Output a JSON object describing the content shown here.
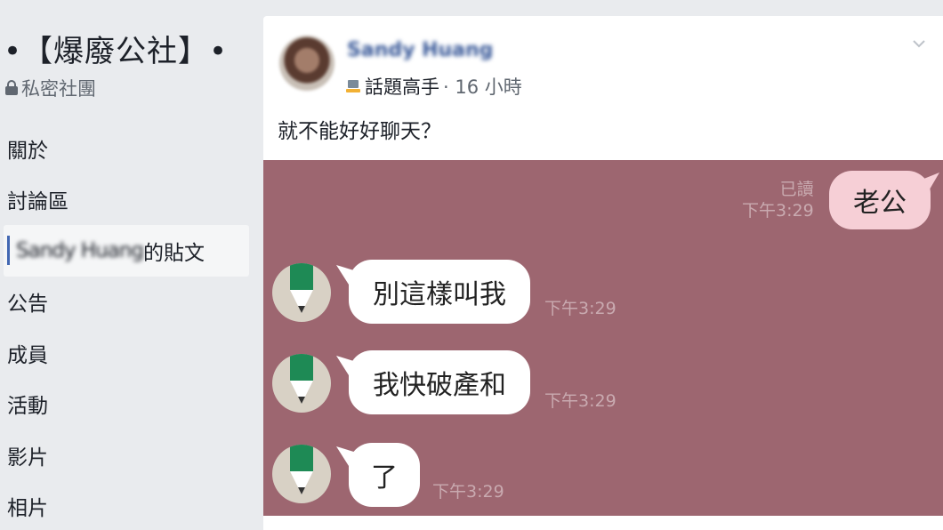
{
  "sidebar": {
    "group_title": "•【爆廢公社】•",
    "group_type": "私密社團",
    "items": [
      {
        "label": "關於"
      },
      {
        "label": "討論區"
      },
      {
        "label": "的貼文",
        "name_blurred": "Sandy Huang",
        "active": true
      },
      {
        "label": "公告"
      },
      {
        "label": "成員"
      },
      {
        "label": "活動"
      },
      {
        "label": "影片"
      },
      {
        "label": "相片"
      }
    ]
  },
  "post": {
    "author": "Sandy Huang",
    "badge": "話題高手",
    "time": "· 16 小時",
    "text": "就不能好好聊天？",
    "icons": [
      "badge-icon",
      "chevron-down-icon"
    ]
  },
  "chat": {
    "messages": [
      {
        "side": "out",
        "text": "老公",
        "read": "已讀",
        "time": "下午3:29"
      },
      {
        "side": "in",
        "text": "別這樣叫我",
        "time": "下午3:29"
      },
      {
        "side": "in",
        "text": "我快破產和",
        "time": "下午3:29"
      },
      {
        "side": "in",
        "text": "了",
        "time": "下午3:29"
      }
    ],
    "colors": {
      "background": "#9d6670",
      "outgoing": "#f6cfd6",
      "incoming": "#ffffff",
      "pencil": "#1e8a55"
    }
  }
}
